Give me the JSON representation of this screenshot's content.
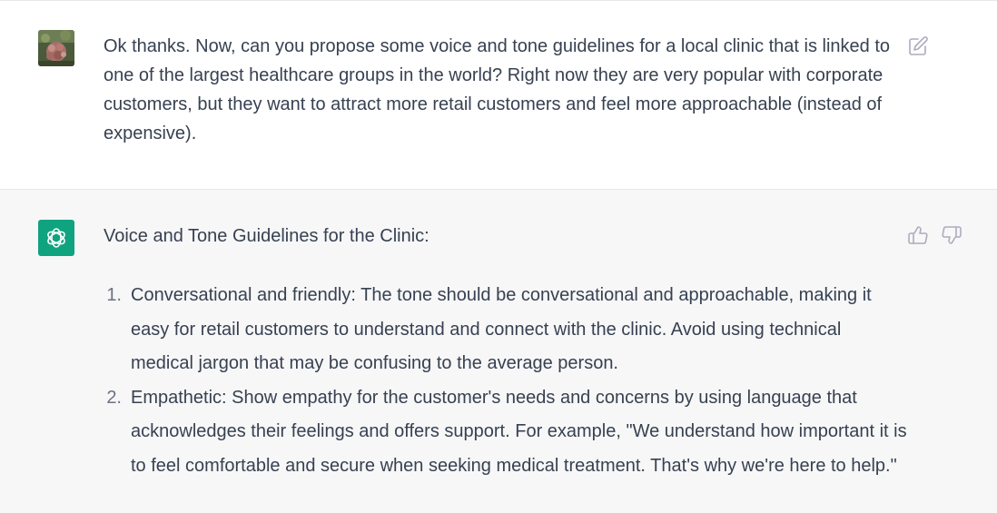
{
  "user_message": {
    "text": "Ok thanks. Now, can you propose some voice and tone guidelines for a local clinic that is linked to  one of the largest healthcare groups in the world? Right now they are very popular with corporate customers, but they want to attract more retail customers and feel more approachable (instead of expensive).",
    "avatar_icon": "flower-photo-avatar",
    "edit_icon": "edit-icon"
  },
  "assistant_message": {
    "avatar_icon": "openai-logo-icon",
    "avatar_color": "#10a37f",
    "intro": "Voice and Tone Guidelines for the Clinic:",
    "items": [
      {
        "number": "1.",
        "text": "Conversational and friendly: The tone should be conversational and approachable, making it easy for retail customers to understand and connect with the clinic. Avoid using technical medical jargon that may be confusing to the average person."
      },
      {
        "number": "2.",
        "text": "Empathetic: Show empathy for the customer's needs and concerns by using language that acknowledges their feelings and offers support. For example, \"We understand how important it is to feel comfortable and secure when seeking medical treatment. That's why we're here to help.\""
      }
    ],
    "feedback_icons": [
      "thumbs-up-icon",
      "thumbs-down-icon"
    ]
  },
  "colors": {
    "text": "#374151",
    "icon": "#acacbe",
    "assistant_bg": "#f7f7f8",
    "brand": "#10a37f"
  }
}
